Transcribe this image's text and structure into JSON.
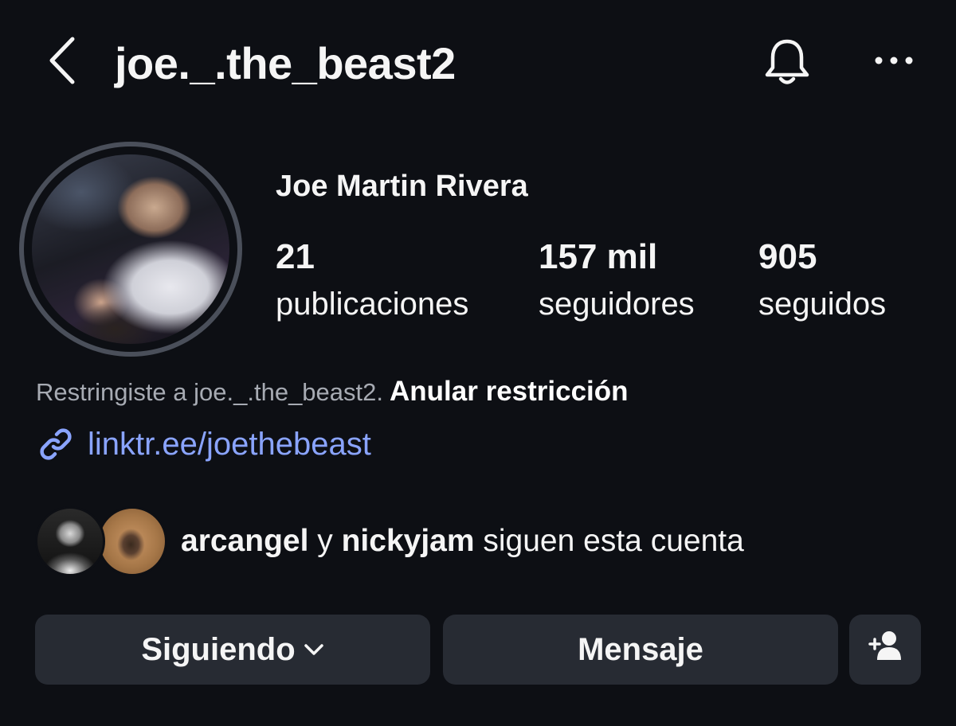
{
  "header": {
    "back_icon": "chevron-left-icon",
    "username": "joe._.the_beast2",
    "bell_icon": "bell-icon",
    "more_icon": "more-horizontal-icon"
  },
  "profile": {
    "full_name": "Joe Martin Rivera",
    "stats": [
      {
        "value": "21",
        "label": "publicaciones"
      },
      {
        "value": "157 mil",
        "label": "seguidores"
      },
      {
        "value": "905",
        "label": "seguidos"
      }
    ]
  },
  "restriction": {
    "text": "Restringiste a joe._.the_beast2.",
    "action": "Anular restricción"
  },
  "link": {
    "icon": "link-icon",
    "url": "linktr.ee/joethebeast"
  },
  "mutual": {
    "user1": "arcangel",
    "connector": "y",
    "user2": "nickyjam",
    "suffix": "siguen esta cuenta"
  },
  "buttons": {
    "following": "Siguiendo",
    "following_icon": "chevron-down-icon",
    "message": "Mensaje",
    "suggest_icon": "add-person-icon"
  },
  "colors": {
    "background": "#0d0f14",
    "button_bg": "#272b33",
    "link": "#8aa4ff",
    "muted_text": "#a7abb3"
  }
}
